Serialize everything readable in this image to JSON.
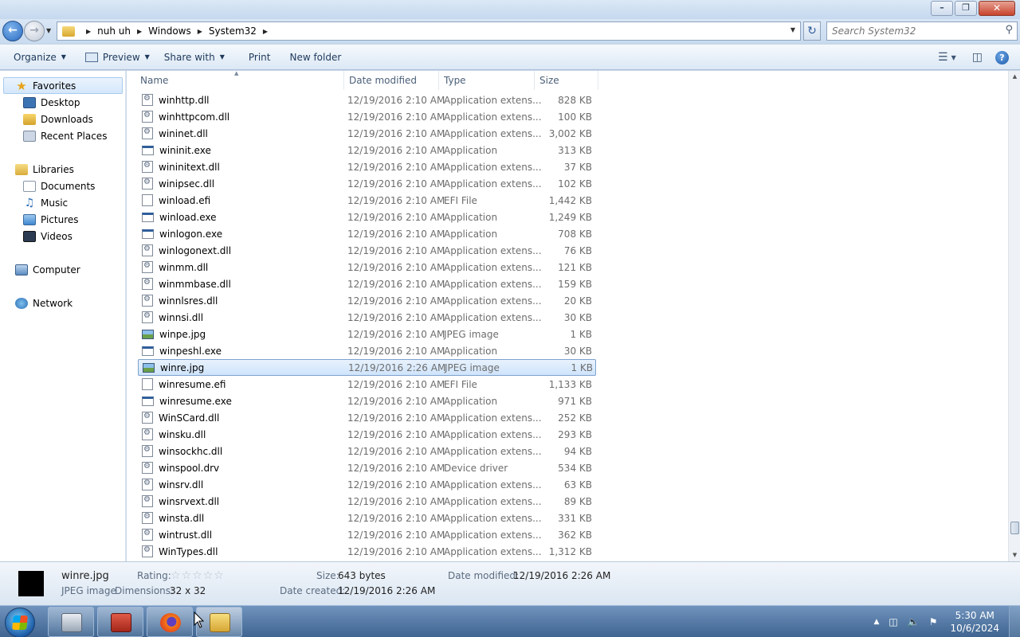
{
  "window": {
    "minimize_glyph": "–",
    "maximize_glyph": "❐",
    "close_glyph": "✕"
  },
  "address": {
    "crumbs": [
      "nuh uh",
      "Windows",
      "System32"
    ],
    "search_placeholder": "Search System32"
  },
  "toolbar": {
    "organize": "Organize",
    "preview": "Preview",
    "share_with": "Share with",
    "print": "Print",
    "new_folder": "New folder",
    "help": "?"
  },
  "sidebar": {
    "favorites": "Favorites",
    "desktop": "Desktop",
    "downloads": "Downloads",
    "recent_places": "Recent Places",
    "libraries": "Libraries",
    "documents": "Documents",
    "music": "Music",
    "pictures": "Pictures",
    "videos": "Videos",
    "computer": "Computer",
    "network": "Network"
  },
  "columns": {
    "name": "Name",
    "date_modified": "Date modified",
    "type": "Type",
    "size": "Size"
  },
  "files": [
    {
      "name": "winhttp.dll",
      "date": "12/19/2016 2:10 AM",
      "type": "Application extens...",
      "size": "828 KB",
      "icon": "dll"
    },
    {
      "name": "winhttpcom.dll",
      "date": "12/19/2016 2:10 AM",
      "type": "Application extens...",
      "size": "100 KB",
      "icon": "dll"
    },
    {
      "name": "wininet.dll",
      "date": "12/19/2016 2:10 AM",
      "type": "Application extens...",
      "size": "3,002 KB",
      "icon": "dll"
    },
    {
      "name": "wininit.exe",
      "date": "12/19/2016 2:10 AM",
      "type": "Application",
      "size": "313 KB",
      "icon": "exe"
    },
    {
      "name": "wininitext.dll",
      "date": "12/19/2016 2:10 AM",
      "type": "Application extens...",
      "size": "37 KB",
      "icon": "dll"
    },
    {
      "name": "winipsec.dll",
      "date": "12/19/2016 2:10 AM",
      "type": "Application extens...",
      "size": "102 KB",
      "icon": "dll"
    },
    {
      "name": "winload.efi",
      "date": "12/19/2016 2:10 AM",
      "type": "EFI File",
      "size": "1,442 KB",
      "icon": "efi"
    },
    {
      "name": "winload.exe",
      "date": "12/19/2016 2:10 AM",
      "type": "Application",
      "size": "1,249 KB",
      "icon": "exe"
    },
    {
      "name": "winlogon.exe",
      "date": "12/19/2016 2:10 AM",
      "type": "Application",
      "size": "708 KB",
      "icon": "exe"
    },
    {
      "name": "winlogonext.dll",
      "date": "12/19/2016 2:10 AM",
      "type": "Application extens...",
      "size": "76 KB",
      "icon": "dll"
    },
    {
      "name": "winmm.dll",
      "date": "12/19/2016 2:10 AM",
      "type": "Application extens...",
      "size": "121 KB",
      "icon": "dll"
    },
    {
      "name": "winmmbase.dll",
      "date": "12/19/2016 2:10 AM",
      "type": "Application extens...",
      "size": "159 KB",
      "icon": "dll"
    },
    {
      "name": "winnlsres.dll",
      "date": "12/19/2016 2:10 AM",
      "type": "Application extens...",
      "size": "20 KB",
      "icon": "dll"
    },
    {
      "name": "winnsi.dll",
      "date": "12/19/2016 2:10 AM",
      "type": "Application extens...",
      "size": "30 KB",
      "icon": "dll"
    },
    {
      "name": "winpe.jpg",
      "date": "12/19/2016 2:10 AM",
      "type": "JPEG image",
      "size": "1 KB",
      "icon": "jpg"
    },
    {
      "name": "winpeshl.exe",
      "date": "12/19/2016 2:10 AM",
      "type": "Application",
      "size": "30 KB",
      "icon": "exe"
    },
    {
      "name": "winre.jpg",
      "date": "12/19/2016 2:26 AM",
      "type": "JPEG image",
      "size": "1 KB",
      "icon": "jpg",
      "selected": true
    },
    {
      "name": "winresume.efi",
      "date": "12/19/2016 2:10 AM",
      "type": "EFI File",
      "size": "1,133 KB",
      "icon": "efi"
    },
    {
      "name": "winresume.exe",
      "date": "12/19/2016 2:10 AM",
      "type": "Application",
      "size": "971 KB",
      "icon": "exe"
    },
    {
      "name": "WinSCard.dll",
      "date": "12/19/2016 2:10 AM",
      "type": "Application extens...",
      "size": "252 KB",
      "icon": "dll"
    },
    {
      "name": "winsku.dll",
      "date": "12/19/2016 2:10 AM",
      "type": "Application extens...",
      "size": "293 KB",
      "icon": "dll"
    },
    {
      "name": "winsockhc.dll",
      "date": "12/19/2016 2:10 AM",
      "type": "Application extens...",
      "size": "94 KB",
      "icon": "dll"
    },
    {
      "name": "winspool.drv",
      "date": "12/19/2016 2:10 AM",
      "type": "Device driver",
      "size": "534 KB",
      "icon": "drv"
    },
    {
      "name": "winsrv.dll",
      "date": "12/19/2016 2:10 AM",
      "type": "Application extens...",
      "size": "63 KB",
      "icon": "dll"
    },
    {
      "name": "winsrvext.dll",
      "date": "12/19/2016 2:10 AM",
      "type": "Application extens...",
      "size": "89 KB",
      "icon": "dll"
    },
    {
      "name": "winsta.dll",
      "date": "12/19/2016 2:10 AM",
      "type": "Application extens...",
      "size": "331 KB",
      "icon": "dll"
    },
    {
      "name": "wintrust.dll",
      "date": "12/19/2016 2:10 AM",
      "type": "Application extens...",
      "size": "362 KB",
      "icon": "dll"
    },
    {
      "name": "WinTypes.dll",
      "date": "12/19/2016 2:10 AM",
      "type": "Application extens...",
      "size": "1,312 KB",
      "icon": "dll"
    }
  ],
  "details": {
    "filename": "winre.jpg",
    "filetype": "JPEG image",
    "rating_label": "Rating:",
    "rating_value": 0,
    "dimensions_label": "Dimensions:",
    "dimensions_value": "32 x 32",
    "size_label": "Size:",
    "size_value": "643 bytes",
    "date_created_label": "Date created:",
    "date_created_value": "12/19/2016 2:26 AM",
    "date_modified_label": "Date modified:",
    "date_modified_value": "12/19/2016 2:26 AM"
  },
  "taskbar": {
    "time": "5:30 AM",
    "date": "10/6/2024"
  }
}
